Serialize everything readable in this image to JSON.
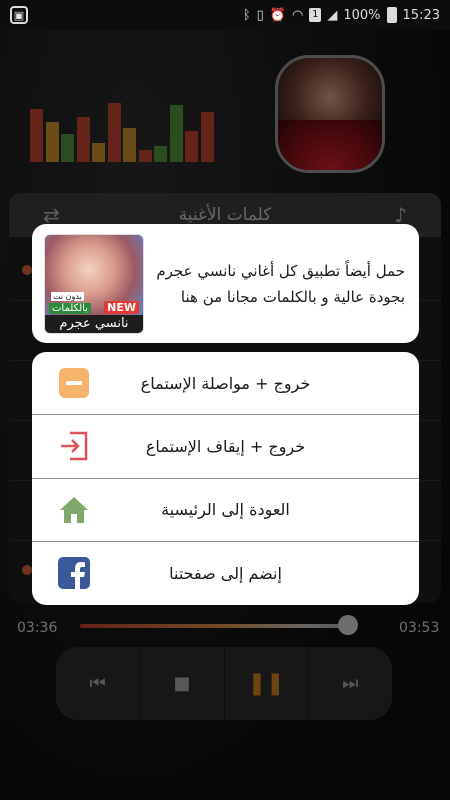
{
  "status_bar": {
    "battery": "100%",
    "time": "15:23"
  },
  "player": {
    "header_title": "كلمات الأغنية",
    "elapsed": "03:36",
    "duration": "03:53",
    "progress": 0.93,
    "equalizer": [
      {
        "level": 0.85,
        "color": "#b8432e"
      },
      {
        "level": 0.65,
        "color": "#c38a2f"
      },
      {
        "level": 0.45,
        "color": "#4d8a3a"
      },
      {
        "level": 0.72,
        "color": "#b8432e"
      },
      {
        "level": 0.3,
        "color": "#c38a2f"
      },
      {
        "level": 0.95,
        "color": "#b8432e"
      },
      {
        "level": 0.55,
        "color": "#c38a2f"
      },
      {
        "level": 0.2,
        "color": "#b8432e"
      },
      {
        "level": 0.25,
        "color": "#4d8a3a"
      },
      {
        "level": 0.92,
        "color": "#4d8a3a"
      },
      {
        "level": 0.5,
        "color": "#b8432e"
      },
      {
        "level": 0.8,
        "color": "#b8432e"
      }
    ]
  },
  "promo": {
    "text": "حمل أيضاً تطبيق كل أغاني نانسي عجرم بجودة عالية و بالكلمات مجانا من هنا",
    "badge_new": "NEW",
    "badge_no_net": "بدون نت",
    "badge_lyrics": "بالكلمات",
    "app_name": "نانسي عجرم"
  },
  "menu": {
    "items": [
      {
        "label": "خروج + مواصلة الإستماع",
        "icon": "minus-square-icon",
        "color": "#f5b36b"
      },
      {
        "label": "خروج + إيقاف الإستماع",
        "icon": "exit-icon",
        "color": "#e0525a"
      },
      {
        "label": "العودة إلى الرئيسية",
        "icon": "home-icon",
        "color": "#7fa86a"
      },
      {
        "label": "إنضم إلى صفحتنا",
        "icon": "facebook-icon",
        "color": "#3b5998"
      }
    ]
  }
}
